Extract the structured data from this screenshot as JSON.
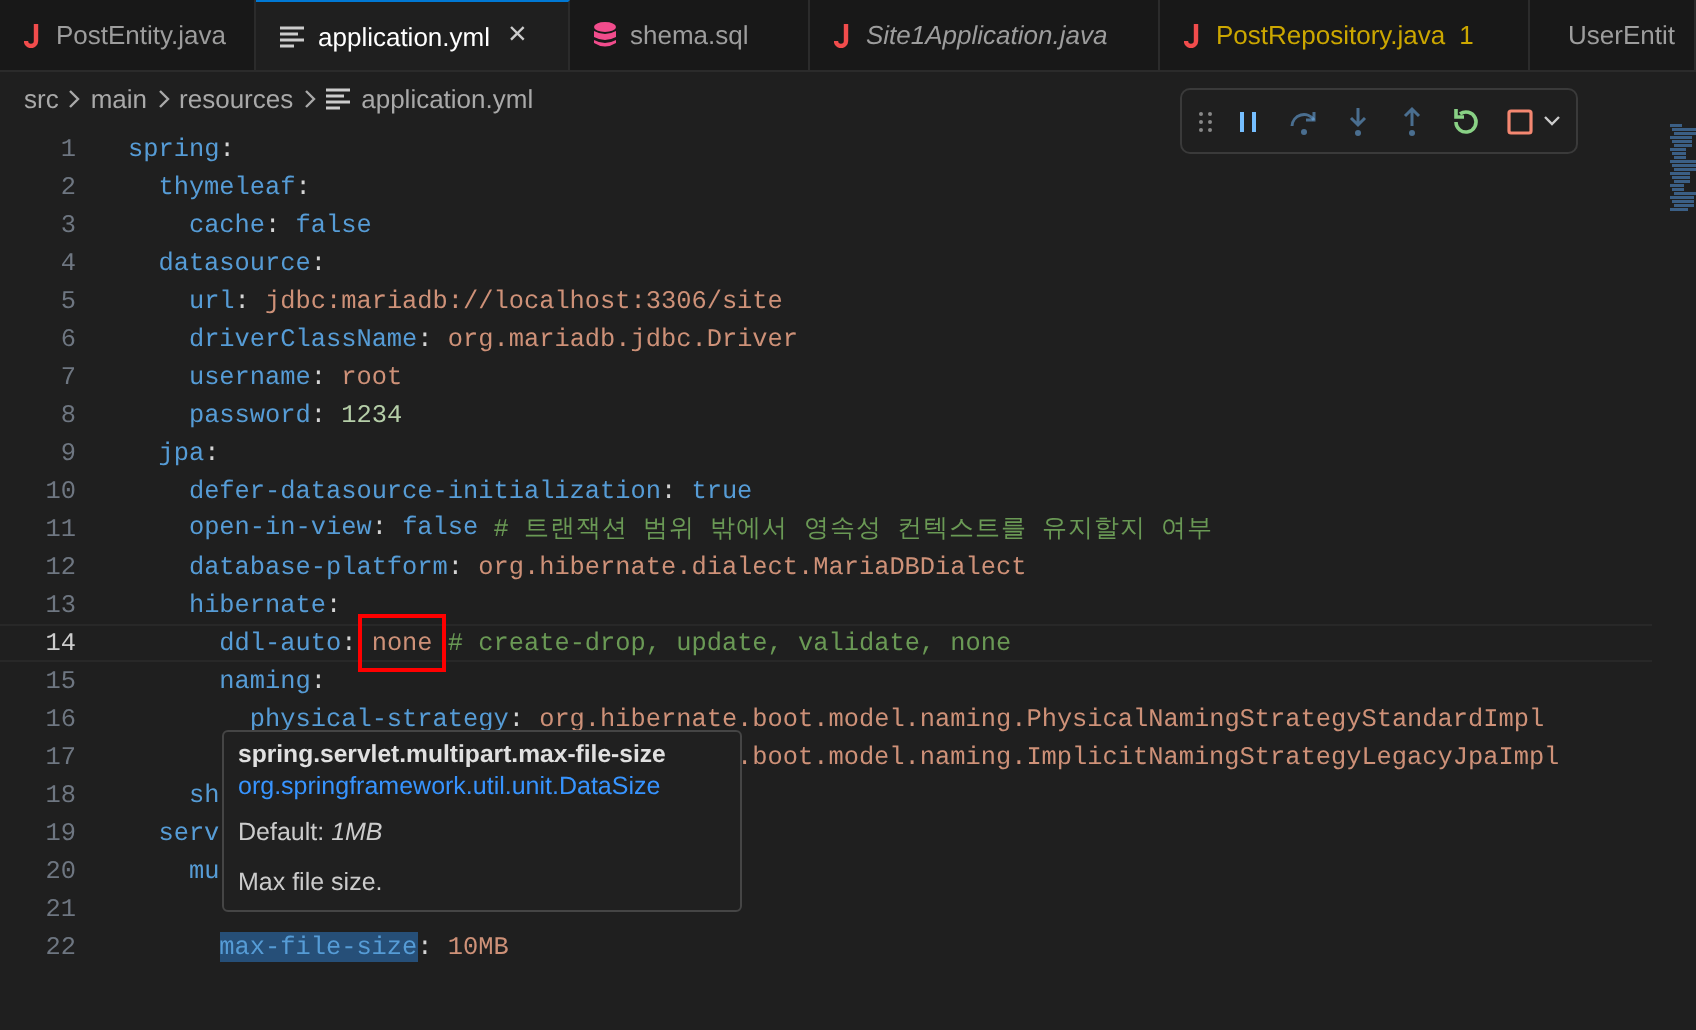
{
  "tabs": [
    {
      "label": "PostEntity.java",
      "kind": "java",
      "selected": false,
      "preview": false,
      "warning": false
    },
    {
      "label": "application.yml",
      "kind": "yaml",
      "selected": true,
      "preview": false,
      "warning": false,
      "close": "×"
    },
    {
      "label": "shema.sql",
      "kind": "sql",
      "selected": false,
      "preview": false,
      "warning": false
    },
    {
      "label": "Site1Application.java",
      "kind": "java",
      "selected": false,
      "preview": true,
      "warning": false
    },
    {
      "label": "PostRepository.java",
      "kind": "java",
      "selected": false,
      "preview": false,
      "warning": true,
      "problems": "1"
    },
    {
      "label": "UserEntit",
      "kind": "java",
      "selected": false,
      "preview": false,
      "warning": false
    }
  ],
  "breadcrumb": [
    {
      "label": "src",
      "kind": "folder"
    },
    {
      "label": "main",
      "kind": "folder"
    },
    {
      "label": "resources",
      "kind": "folder"
    },
    {
      "label": "application.yml",
      "kind": "yaml"
    }
  ],
  "editor": {
    "lines": [
      {
        "number": "1",
        "current": false,
        "tokens": [
          {
            "kind": "key",
            "text": "spring"
          },
          {
            "kind": "punct",
            "text": ":"
          }
        ],
        "children": [
          {
            "number": "2",
            "current": false,
            "tokens": [
              {
                "kind": "key",
                "text": "thymeleaf"
              },
              {
                "kind": "punct",
                "text": ":"
              }
            ],
            "children": [
              {
                "number": "3",
                "current": false,
                "tokens": [
                  {
                    "kind": "key",
                    "text": "cache"
                  },
                  {
                    "kind": "punct",
                    "text": ": "
                  },
                  {
                    "kind": "bool",
                    "text": "false"
                  }
                ]
              }
            ]
          },
          {
            "number": "4",
            "current": false,
            "tokens": [
              {
                "kind": "key",
                "text": "datasource"
              },
              {
                "kind": "punct",
                "text": ":"
              }
            ],
            "children": [
              {
                "number": "5",
                "current": false,
                "tokens": [
                  {
                    "kind": "key",
                    "text": "url"
                  },
                  {
                    "kind": "punct",
                    "text": ": "
                  },
                  {
                    "kind": "string",
                    "text": "jdbc:mariadb://localhost:3306/site"
                  }
                ]
              },
              {
                "number": "6",
                "current": false,
                "tokens": [
                  {
                    "kind": "key",
                    "text": "driverClassName"
                  },
                  {
                    "kind": "punct",
                    "text": ": "
                  },
                  {
                    "kind": "string",
                    "text": "org.mariadb.jdbc.Driver"
                  }
                ]
              },
              {
                "number": "7",
                "current": false,
                "tokens": [
                  {
                    "kind": "key",
                    "text": "username"
                  },
                  {
                    "kind": "punct",
                    "text": ": "
                  },
                  {
                    "kind": "string",
                    "text": "root"
                  }
                ]
              },
              {
                "number": "8",
                "current": false,
                "tokens": [
                  {
                    "kind": "key",
                    "text": "password"
                  },
                  {
                    "kind": "punct",
                    "text": ": "
                  },
                  {
                    "kind": "number",
                    "text": "1234"
                  }
                ]
              }
            ]
          },
          {
            "number": "9",
            "current": false,
            "tokens": [
              {
                "kind": "key",
                "text": "jpa"
              },
              {
                "kind": "punct",
                "text": ":"
              }
            ],
            "children": [
              {
                "number": "10",
                "current": false,
                "tokens": [
                  {
                    "kind": "key",
                    "text": "defer-datasource-initialization"
                  },
                  {
                    "kind": "punct",
                    "text": ": "
                  },
                  {
                    "kind": "bool",
                    "text": "true"
                  }
                ]
              },
              {
                "number": "11",
                "current": false,
                "tokens": [
                  {
                    "kind": "key",
                    "text": "open-in-view"
                  },
                  {
                    "kind": "punct",
                    "text": ": "
                  },
                  {
                    "kind": "bool",
                    "text": "false"
                  },
                  {
                    "kind": "comment",
                    "text": " # 트랜잭션 범위 밖에서 영속성 컨텍스트를 유지할지 여부"
                  }
                ]
              },
              {
                "number": "12",
                "current": false,
                "tokens": [
                  {
                    "kind": "key",
                    "text": "database-platform"
                  },
                  {
                    "kind": "punct",
                    "text": ": "
                  },
                  {
                    "kind": "string",
                    "text": "org.hibernate.dialect.MariaDBDialect"
                  }
                ]
              },
              {
                "number": "13",
                "current": false,
                "tokens": [
                  {
                    "kind": "key",
                    "text": "hibernate"
                  },
                  {
                    "kind": "punct",
                    "text": ":"
                  }
                ],
                "children": [
                  {
                    "number": "14",
                    "current": true,
                    "tokens": [
                      {
                        "kind": "key",
                        "text": "ddl-auto"
                      },
                      {
                        "kind": "punct",
                        "text": ": "
                      },
                      {
                        "kind": "string",
                        "text": "none",
                        "marked": true
                      },
                      {
                        "kind": "comment",
                        "text": " # create-drop, update, validate, none"
                      }
                    ]
                  },
                  {
                    "number": "15",
                    "current": false,
                    "tokens": [
                      {
                        "kind": "key",
                        "text": "naming"
                      },
                      {
                        "kind": "punct",
                        "text": ":"
                      }
                    ],
                    "children": [
                      {
                        "number": "16",
                        "current": false,
                        "tokens": [
                          {
                            "kind": "key",
                            "text": "physical-strategy"
                          },
                          {
                            "kind": "punct",
                            "text": ": "
                          },
                          {
                            "kind": "string",
                            "text": "org.hibernate.boot.model.naming.PhysicalNamingStrategyStandardImpl"
                          }
                        ]
                      },
                      {
                        "number": "17",
                        "current": false,
                        "tokens": [
                          {
                            "kind": "string",
                            "text": ".boot.model.naming.ImplicitNamingStrategyLegacyJpaImpl",
                            "partial": true
                          }
                        ]
                      }
                    ]
                  }
                ]
              },
              {
                "number": "18",
                "current": false,
                "tokens": [
                  {
                    "kind": "key",
                    "text": "sh"
                  }
                ]
              }
            ]
          },
          {
            "number": "19",
            "current": false,
            "tokens": [
              {
                "kind": "key",
                "text": "serv"
              }
            ],
            "children": [
              {
                "number": "20",
                "current": false,
                "tokens": [
                  {
                    "kind": "key",
                    "text": "mu"
                  }
                ],
                "children": [
                  {
                    "number": "21",
                    "current": false
                  },
                  {
                    "number": "22",
                    "current": false,
                    "tokens": [
                      {
                        "kind": "key",
                        "text": "max-file-size",
                        "highlighted": true
                      },
                      {
                        "kind": "punct",
                        "text": ": "
                      },
                      {
                        "kind": "string",
                        "text": "10MB"
                      }
                    ]
                  }
                ]
              }
            ]
          }
        ]
      }
    ]
  },
  "hover": {
    "title": "spring.servlet.multipart.max-file-size",
    "type_link": "org.springframework.util.unit.DataSize",
    "default": "Default: *1MB*",
    "description": "Max file size."
  }
}
